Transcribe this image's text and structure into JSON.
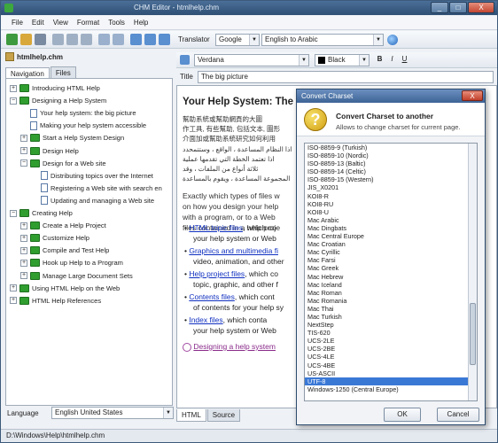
{
  "window": {
    "title": "CHM Editor - htmlhelp.chm",
    "min": "_",
    "max": "□",
    "close": "X"
  },
  "menu": [
    "File",
    "Edit",
    "View",
    "Format",
    "Tools",
    "Help"
  ],
  "toolbar": {
    "translator_label": "Translator",
    "engine": "Google",
    "direction": "English to Arabic"
  },
  "left": {
    "file_name": "htmlhelp.chm",
    "tabs": [
      "Navigation",
      "Files"
    ],
    "tree": [
      {
        "label": "Introducing HTML Help",
        "type": "book",
        "level": 0,
        "exp": "+"
      },
      {
        "label": "Designing a Help System",
        "type": "book",
        "level": 0,
        "exp": "−"
      },
      {
        "label": "Your help system: the big picture",
        "type": "page",
        "level": 1
      },
      {
        "label": "Making your help system accessible",
        "type": "page",
        "level": 1
      },
      {
        "label": "Start a Help System Design",
        "type": "book",
        "level": 1,
        "exp": "+"
      },
      {
        "label": "Design Help",
        "type": "book",
        "level": 1,
        "exp": "+"
      },
      {
        "label": "Design for a Web site",
        "type": "book",
        "level": 1,
        "exp": "−"
      },
      {
        "label": "Distributing topics over the Internet",
        "type": "page",
        "level": 2
      },
      {
        "label": "Registering a Web site with search en",
        "type": "page",
        "level": 2
      },
      {
        "label": "Updating and managing a Web site",
        "type": "page",
        "level": 2
      },
      {
        "label": "Creating Help",
        "type": "book",
        "level": 0,
        "exp": "−"
      },
      {
        "label": "Create a Help Project",
        "type": "book",
        "level": 1,
        "exp": "+"
      },
      {
        "label": "Customize Help",
        "type": "book",
        "level": 1,
        "exp": "+"
      },
      {
        "label": "Compile and Test Help",
        "type": "book",
        "level": 1,
        "exp": "+"
      },
      {
        "label": "Hook up Help to a Program",
        "type": "book",
        "level": 1,
        "exp": "+"
      },
      {
        "label": "Manage Large Document Sets",
        "type": "book",
        "level": 1,
        "exp": "+"
      },
      {
        "label": "Using HTML Help on the Web",
        "type": "book",
        "level": 0,
        "exp": "+"
      },
      {
        "label": "HTML Help References",
        "type": "book",
        "level": 0,
        "exp": "+"
      }
    ],
    "language_label": "Language",
    "language_value": "English United States"
  },
  "editor": {
    "font": "Verdana",
    "color": "Black",
    "title_label": "Title",
    "title_value": "The big picture",
    "heading": "Your Help System: The",
    "cjk_lines": [
      "幫助系統或幫助網頁的大圖",
      "作工具, 有些幫助, 包括文本, 圖形",
      "介面加或幫助系統研究如何利用"
    ],
    "arabic_lines": [
      "اذا النظام المساعدة ، الواقع ، وستتمحدد",
      "اذا تعتمد الخطة التي تقدمها عملية",
      "ثلاثة أنواع من الملفات ، وقد",
      "المجموعة المساعدة ، ويقوم بالمساعدة"
    ],
    "paragraph": [
      "Exactly which types of files w",
      "on how you design your help",
      "with a program, or to a Web",
      "files contained in a help proje"
    ],
    "bullets": [
      {
        "link": "HTML topic files",
        "text": ", which co",
        "lines": [
          "your help system or Web"
        ]
      },
      {
        "link": "Graphics and multimedia fi",
        "text": "",
        "lines": [
          "video, animation, and other"
        ]
      },
      {
        "link": "Help project files",
        "text": ", which co",
        "lines": [
          "topic, graphic, and other f"
        ]
      },
      {
        "link": "Contents files",
        "text": ", which cont",
        "lines": [
          "of contents for your help sy"
        ]
      },
      {
        "link": "Index files",
        "text": ", which conta",
        "lines": [
          "your help system or Web"
        ]
      }
    ],
    "related_link": "Designing a help system",
    "bottom_tabs": [
      "HTML",
      "Source"
    ]
  },
  "dialog": {
    "title": "Convert Charset",
    "heading": "Convert Charset to another",
    "subtitle": "Allows to change charset for current page.",
    "options": [
      "ISO-8859-9 (Turkish)",
      "ISO-8859-10 (Nordic)",
      "ISO-8859-13 (Baltic)",
      "ISO-8859-14 (Celtic)",
      "ISO-8859-15 (Western)",
      "JIS_X0201",
      "KOI8-R",
      "KOI8-RU",
      "KOI8-U",
      "Mac Arabic",
      "Mac Dingbats",
      "Mac Central Europe",
      "Mac Croatian",
      "Mac Cyrillic",
      "Mac Farsi",
      "Mac Greek",
      "Mac Hebrew",
      "Mac Iceland",
      "Mac Roman",
      "Mac Romania",
      "Mac Thai",
      "Mac Turkish",
      "NextStep",
      "TIS-620",
      "UCS-2LE",
      "UCS-2BE",
      "UCS-4LE",
      "UCS-4BE",
      "US-ASCII",
      "UTF-8",
      "Windows-1250 (Central Europe)"
    ],
    "selected": "UTF-8",
    "ok": "OK",
    "cancel": "Cancel"
  },
  "status": "D:\\Windows\\Help\\htmlhelp.chm"
}
